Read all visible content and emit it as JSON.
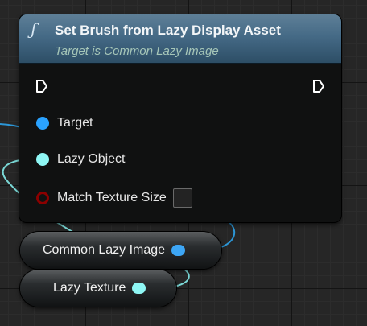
{
  "node": {
    "icon": "function-icon",
    "title": "Set Brush from Lazy Display Asset",
    "subtitle": "Target is Common Lazy Image",
    "pins": {
      "target_label": "Target",
      "lazy_object_label": "Lazy Object",
      "match_texture_size_label": "Match Texture Size",
      "match_texture_size_checked": false
    }
  },
  "variables": [
    {
      "label": "Common Lazy Image"
    },
    {
      "label": "Lazy Texture"
    }
  ],
  "colors": {
    "header_accent": "#456a86",
    "object_pin": "#2aa2ff",
    "soft_object_pin": "#8ff7f5",
    "boolean_pin": "#8b0000",
    "exec_pin": "#ffffff"
  }
}
